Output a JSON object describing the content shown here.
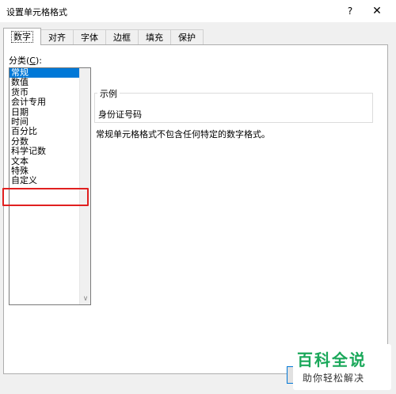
{
  "window": {
    "title": "设置单元格格式",
    "help_label": "?",
    "close_label": "✕"
  },
  "tabs": [
    {
      "label": "数字",
      "active": true
    },
    {
      "label": "对齐",
      "active": false
    },
    {
      "label": "字体",
      "active": false
    },
    {
      "label": "边框",
      "active": false
    },
    {
      "label": "填充",
      "active": false
    },
    {
      "label": "保护",
      "active": false
    }
  ],
  "category": {
    "label_prefix": "分类(",
    "label_hotkey": "C",
    "label_suffix": "):",
    "items": [
      "常规",
      "数值",
      "货币",
      "会计专用",
      "日期",
      "时间",
      "百分比",
      "分数",
      "科学记数",
      "文本",
      "特殊",
      "自定义"
    ],
    "selected": "常规",
    "highlighted": "文本"
  },
  "sample": {
    "legend": "示例",
    "value": "身份证号码"
  },
  "description": "常规单元格格式不包含任何特定的数字格式。",
  "watermark": {
    "title": "百科全说",
    "subtitle": "助你轻松解决"
  },
  "colors": {
    "selection": "#0078d7",
    "highlight_border": "#e02020",
    "watermark_green": "#1aa85a"
  }
}
